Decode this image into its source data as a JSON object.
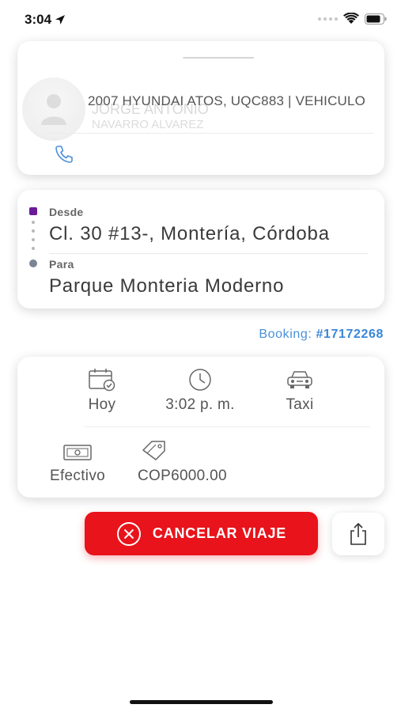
{
  "status_bar": {
    "time": "3:04"
  },
  "driver": {
    "name": "JORGE ANTONIO",
    "subtitle": "NAVARRO ALVAREZ",
    "vehicle": "2007 HYUNDAI ATOS, UQC883 | VEHICULO"
  },
  "route": {
    "from_label": "Desde",
    "from_value": "Cl. 30 #13-, Montería, Córdoba",
    "to_label": "Para",
    "to_value": "Parque Monteria Moderno"
  },
  "booking": {
    "label": "Booking:",
    "number": "#17172268"
  },
  "trip": {
    "day": "Hoy",
    "time": "3:02 p. m.",
    "vehicle_type": "Taxi",
    "payment_method": "Efectivo",
    "fare": "COP6000.00"
  },
  "actions": {
    "cancel_label": "CANCELAR VIAJE"
  },
  "colors": {
    "accent_blue": "#4a90d9",
    "cancel_red": "#e8131b",
    "from_marker": "#6a1b9a",
    "to_marker": "#7a8594"
  }
}
